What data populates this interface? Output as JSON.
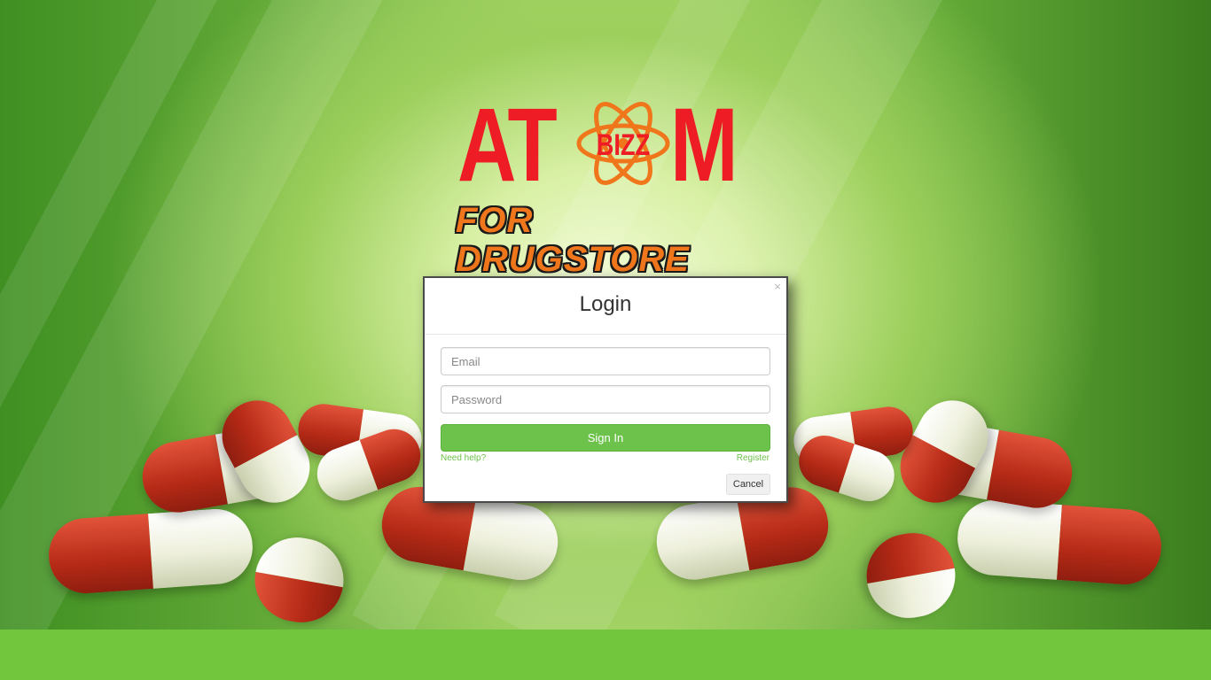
{
  "logo": {
    "part1": "AT",
    "part2": "M",
    "badge": "BIZZ",
    "subtitle": "FOR DRUGSTORE"
  },
  "login_modal": {
    "title": "Login",
    "close_glyph": "×",
    "email_placeholder": "Email",
    "password_placeholder": "Password",
    "signin_label": "Sign In",
    "help_link": "Need help?",
    "register_link": "Register",
    "cancel_label": "Cancel"
  },
  "colors": {
    "accent_green": "#6cc24a",
    "footer_green": "#72c63e",
    "logo_red": "#ee1c25",
    "logo_orange": "#f0761c"
  },
  "icons": [
    "atom-icon",
    "close-icon"
  ]
}
